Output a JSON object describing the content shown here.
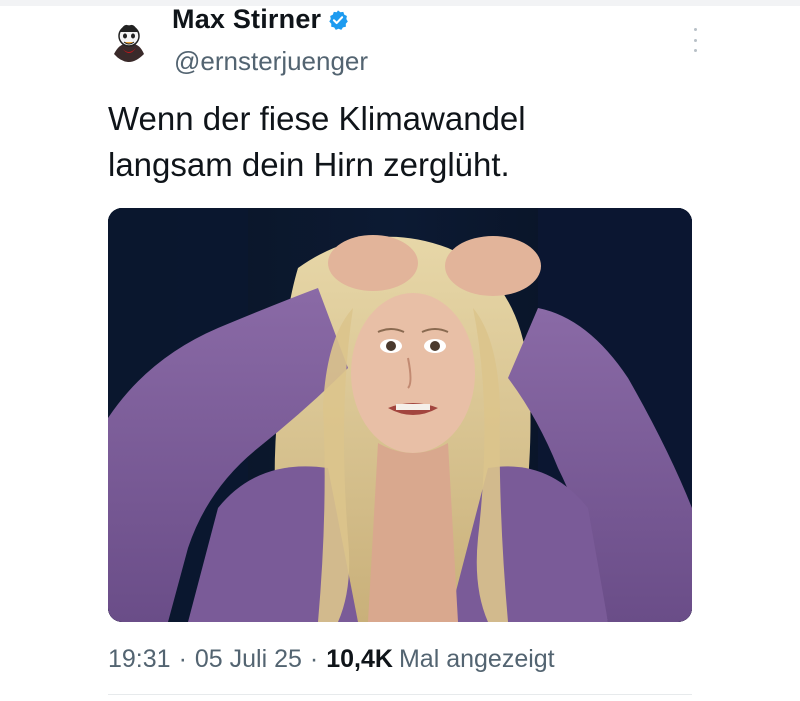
{
  "author": {
    "display_name": "Max Stirner",
    "handle": "@ernsterjuenger",
    "verified": true
  },
  "tweet": {
    "text": "Wenn der fiese Klimawandel\nlangsam dein Hirn zerglüht."
  },
  "meta": {
    "time": "19:31",
    "separator": "·",
    "date": "05 Juli 25",
    "views_count": "10,4K",
    "views_label": "Mal angezeigt"
  },
  "colors": {
    "verified_blue": "#1d9bf0",
    "secondary_text": "#536471",
    "primary_text": "#0f1419"
  },
  "icons": {
    "verified": "verified-badge-icon",
    "more": "more-options-icon"
  }
}
